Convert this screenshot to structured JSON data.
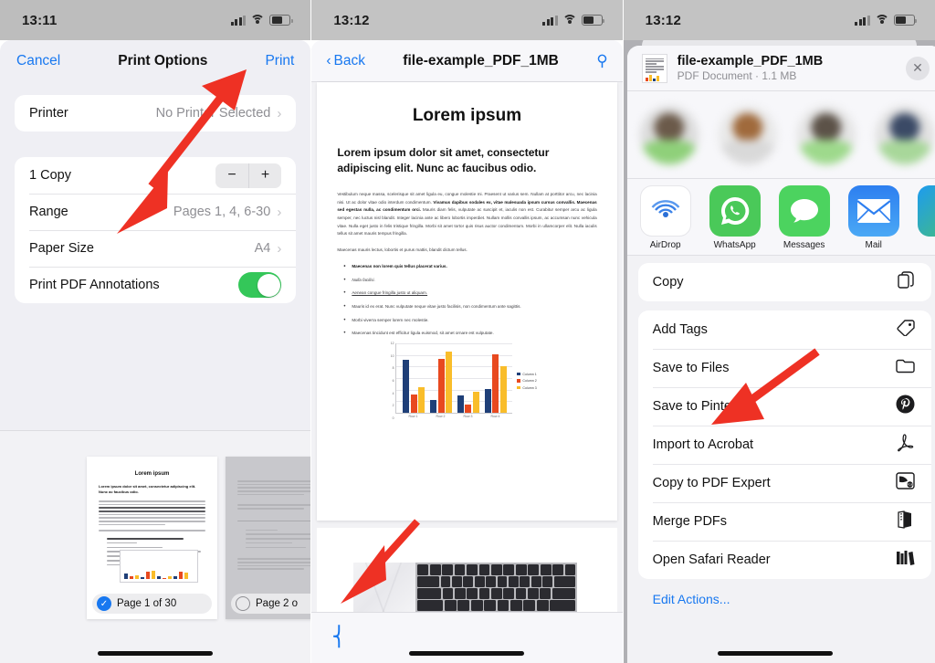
{
  "panels": {
    "print_options": {
      "status": {
        "time": "13:11"
      },
      "nav": {
        "cancel": "Cancel",
        "title": "Print Options",
        "print": "Print"
      },
      "printer_row": {
        "label": "Printer",
        "value": "No Printer Selected"
      },
      "rows": [
        {
          "label": "1 Copy",
          "value": "",
          "control": "stepper",
          "minus": "−",
          "plus": "+"
        },
        {
          "label": "Range",
          "value": "Pages 1, 4, 6-30",
          "control": "chevron"
        },
        {
          "label": "Paper Size",
          "value": "A4",
          "control": "chevron"
        },
        {
          "label": "Print PDF Annotations",
          "value": "",
          "control": "toggle",
          "toggle_on": true
        }
      ],
      "thumbnails": [
        {
          "badge": "Page 1 of 30",
          "selected": true,
          "title": "Lorem ipsum"
        },
        {
          "badge": "Page 2 o",
          "selected": false,
          "title": ""
        }
      ]
    },
    "pdf_viewer": {
      "status": {
        "time": "13:12"
      },
      "nav": {
        "back": "Back",
        "title": "file-example_PDF_1MB",
        "search_icon": "search-icon"
      },
      "document": {
        "title": "Lorem ipsum",
        "subtitle": "Lorem ipsum dolor sit amet, consectetur adipiscing elit. Nunc ac faucibus odio.",
        "paragraph1_pre": "Vestibulum neque massa, scelerisque sit amet ligula eu, congue molestie mi. Praesent ut varius sem. Nullam at porttitor arcu, nec lacinia nisi. Ut ac dolor vitae odio interdum condimentum. ",
        "paragraph1_bold": "Vivamus dapibus sodales ex, vitae malesuada ipsum cursus convallis. Maecenas sed egestas nulla, ac condimentum orci.",
        "paragraph1_post": " Mauris diam felis, vulputate ac suscipit et, iaculis non est. Curabitur semper arcu ac ligula semper, nec luctus nisl blandit. Integer lacinia ante ac libero lobortis imperdiet. Nullam mollis convallis ipsum, ac accumsan nunc vehicula vitae. Nulla eget justo in felis tristique fringilla. Morbi sit amet tortor quis risus auctor condimentum. Morbi in ullamcorper elit. Nulla iaculis tellus sit amet mauris tempus fringilla.",
        "paragraph2": "Maecenas mauris lectus, lobortis et purus mattis, blandit dictum tellus.",
        "bullets": [
          "Maecenas non lorem quis tellus placerat varius.",
          "Nulla facilisi.",
          "Aenean congue fringilla justo ut aliquam.",
          "Mauris id ex erat. Nunc vulputate neque vitae justo facilisis, non condimentum ante sagittis.",
          "Morbi viverra semper lorem nec molestie.",
          "Maecenas tincidunt est efficitur ligula euismod, sit amet ornare est vulputate."
        ]
      },
      "bottom": {
        "share_icon": "share-icon"
      }
    },
    "share_sheet": {
      "status": {
        "time": "13:12"
      },
      "file": {
        "name": "file-example_PDF_1MB",
        "meta": "PDF Document · 1.1 MB",
        "close_icon": "close-icon"
      },
      "people_count": 5,
      "apps": [
        {
          "name": "AirDrop",
          "icon": "airdrop-icon",
          "color": "#ffffff"
        },
        {
          "name": "WhatsApp",
          "icon": "whatsapp-icon",
          "color": "#4ac959"
        },
        {
          "name": "Messages",
          "icon": "messages-icon",
          "color": "#4cd35f"
        },
        {
          "name": "Mail",
          "icon": "mail-icon",
          "color": "#2a8df2"
        },
        {
          "name": "",
          "icon": "partial-app-icon",
          "color": "#1d9bf0"
        }
      ],
      "action_groups": [
        [
          {
            "label": "Copy",
            "icon": "copy-icon",
            "glyph": "❐"
          }
        ],
        [
          {
            "label": "Add Tags",
            "icon": "tag-icon",
            "glyph": "◇"
          },
          {
            "label": "Save to Files",
            "icon": "folder-icon",
            "glyph": "☐"
          },
          {
            "label": "Save to Pinterest",
            "icon": "pinterest-icon",
            "glyph": "ⓟ"
          },
          {
            "label": "Import to Acrobat",
            "icon": "acrobat-icon",
            "glyph": "Δ"
          },
          {
            "label": "Copy to PDF Expert",
            "icon": "pdf-expert-icon",
            "glyph": "▶"
          },
          {
            "label": "Merge PDFs",
            "icon": "merge-pdfs-icon",
            "glyph": "◧"
          },
          {
            "label": "Open Safari Reader",
            "icon": "safari-reader-icon",
            "glyph": "▌"
          }
        ]
      ],
      "edit_actions": "Edit Actions..."
    }
  },
  "chart_data": {
    "type": "bar",
    "title": "",
    "xlabel": "",
    "ylabel": "",
    "ylim": [
      0,
      12
    ],
    "yticks": [
      0,
      2,
      4,
      6,
      8,
      10,
      12
    ],
    "grid": true,
    "legend_position": "right",
    "categories": [
      "Row 1",
      "Row 2",
      "Row 3",
      "Row 4"
    ],
    "series": [
      {
        "name": "Column 1",
        "color": "#1f3f78",
        "values": [
          9.2,
          2.3,
          3.1,
          4.2
        ]
      },
      {
        "name": "Column 2",
        "color": "#e8491f",
        "values": [
          3.2,
          9.3,
          1.5,
          10.1
        ]
      },
      {
        "name": "Column 3",
        "color": "#f9bd2a",
        "values": [
          4.4,
          10.6,
          3.7,
          8.1
        ]
      }
    ]
  },
  "annotations": {
    "arrow_color": "#ee3124",
    "arrows": [
      {
        "name": "arrow-to-page-1-thumbnail",
        "panel": "print_options"
      },
      {
        "name": "arrow-to-share-button",
        "panel": "pdf_viewer"
      },
      {
        "name": "arrow-to-save-to-files",
        "panel": "share_sheet"
      }
    ]
  }
}
